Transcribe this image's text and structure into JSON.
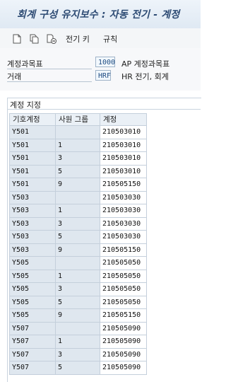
{
  "window": {
    "title": "회계 구성 유지보수 : 자동 전기 - 계정"
  },
  "toolbar": {
    "icons": [
      "new-document-icon",
      "copy-document-icon",
      "delete-document-icon"
    ],
    "posting_key_label": "전기 키",
    "rules_label": "규칙"
  },
  "header_fields": {
    "chart_of_accounts": {
      "label": "계정과목표",
      "value": "1000",
      "description": "AP 계정과목표"
    },
    "transaction": {
      "label": "거래",
      "value": "HRF",
      "description": "HR 전기, 회계"
    }
  },
  "account_assignment": {
    "group_title": "계정 지정",
    "columns": [
      "기호계정",
      "사원 그룹",
      "계정"
    ],
    "rows": [
      {
        "symbol": "Y501",
        "group": "",
        "account": "210503010"
      },
      {
        "symbol": "Y501",
        "group": "1",
        "account": "210503010"
      },
      {
        "symbol": "Y501",
        "group": "3",
        "account": "210503010"
      },
      {
        "symbol": "Y501",
        "group": "5",
        "account": "210503010"
      },
      {
        "symbol": "Y501",
        "group": "9",
        "account": "210505150"
      },
      {
        "symbol": "Y503",
        "group": "",
        "account": "210503030"
      },
      {
        "symbol": "Y503",
        "group": "1",
        "account": "210503030"
      },
      {
        "symbol": "Y503",
        "group": "3",
        "account": "210503030"
      },
      {
        "symbol": "Y503",
        "group": "5",
        "account": "210503030"
      },
      {
        "symbol": "Y503",
        "group": "9",
        "account": "210505150"
      },
      {
        "symbol": "Y505",
        "group": "",
        "account": "210505050"
      },
      {
        "symbol": "Y505",
        "group": "1",
        "account": "210505050"
      },
      {
        "symbol": "Y505",
        "group": "3",
        "account": "210505050"
      },
      {
        "symbol": "Y505",
        "group": "5",
        "account": "210505050"
      },
      {
        "symbol": "Y505",
        "group": "9",
        "account": "210505150"
      },
      {
        "symbol": "Y507",
        "group": "",
        "account": "210505090"
      },
      {
        "symbol": "Y507",
        "group": "1",
        "account": "210505090"
      },
      {
        "symbol": "Y507",
        "group": "3",
        "account": "210505090"
      },
      {
        "symbol": "Y507",
        "group": "5",
        "account": "210505090"
      }
    ]
  }
}
